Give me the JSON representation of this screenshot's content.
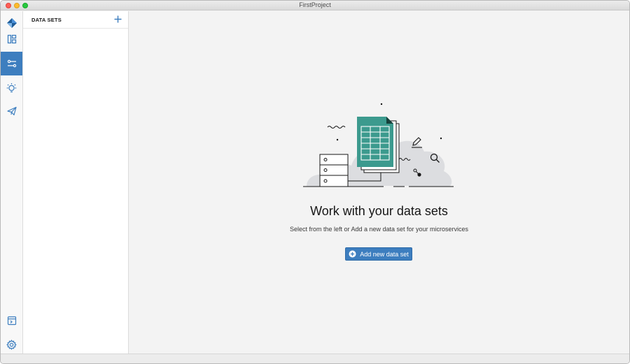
{
  "window": {
    "title": "FirstProject"
  },
  "rail": {
    "items": [
      {
        "icon": "app-logo-icon",
        "active": false
      },
      {
        "icon": "dashboard-icon",
        "active": false
      },
      {
        "icon": "sliders-icon",
        "active": true
      },
      {
        "icon": "bulb-icon",
        "active": false
      },
      {
        "icon": "send-icon",
        "active": false
      },
      {
        "icon": "terminal-window-icon",
        "active": false
      },
      {
        "icon": "gear-icon",
        "active": false
      }
    ]
  },
  "panel": {
    "title": "DATA SETS",
    "add_icon": "plus-icon"
  },
  "empty_state": {
    "title": "Work with your data sets",
    "subtitle": "Select from the left or Add a new data set for your microservices",
    "button_label": "Add new data set",
    "button_icon": "add-circle-icon"
  },
  "colors": {
    "accent": "#3d7ebf",
    "teal_doc": "#3c9a8e",
    "background": "#f3f3f3"
  }
}
